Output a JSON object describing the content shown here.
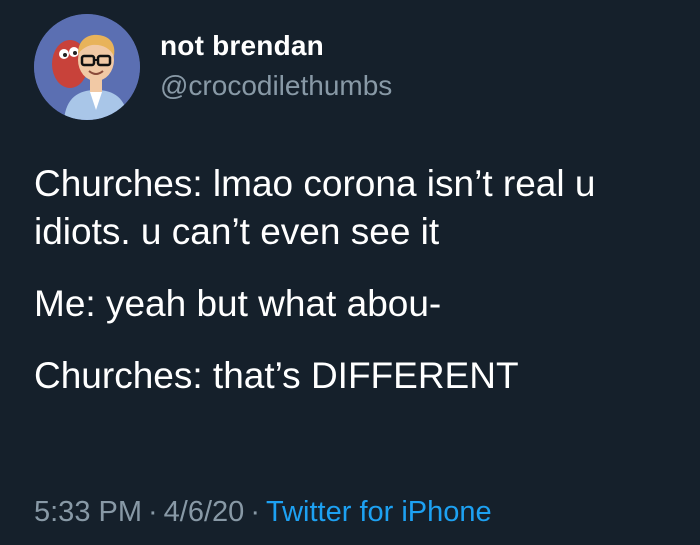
{
  "author": {
    "display_name": "not brendan",
    "handle": "@crocodilethumbs",
    "avatar_icon": "profile-avatar-cartoon"
  },
  "tweet": {
    "paragraphs": [
      "Churches: lmao corona isn’t real u idiots. u can’t even see it",
      "Me: yeah but what abou-",
      "Churches: that’s DIFFERENT"
    ]
  },
  "meta": {
    "time": "5:33 PM",
    "separator": "·",
    "date": "4/6/20",
    "source": "Twitter for iPhone"
  },
  "colors": {
    "background": "#15202b",
    "text": "#ffffff",
    "secondary_text": "#8899a6",
    "link": "#1da1f2"
  }
}
